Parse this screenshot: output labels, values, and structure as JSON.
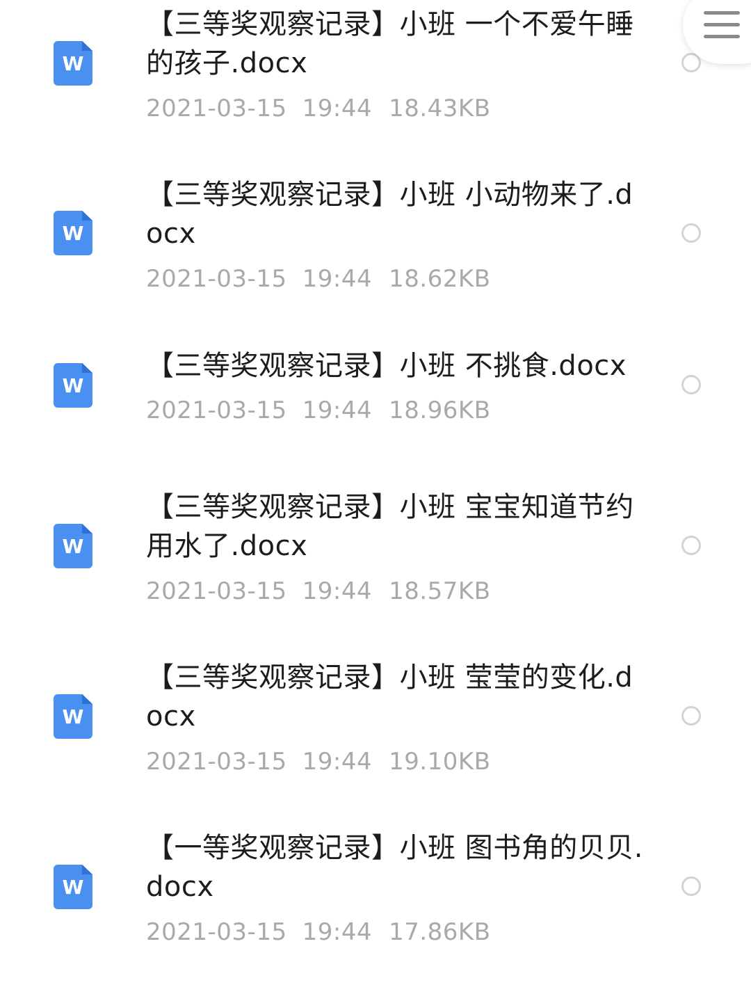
{
  "menu": {
    "icon": "menu-icon"
  },
  "files": [
    {
      "name": "【三等奖观察记录】小班 一个不爱午睡的孩子.docx",
      "date": "2021-03-15",
      "time": "19:44",
      "size": "18.43KB",
      "icon": "word-doc-icon",
      "icon_letter": "W"
    },
    {
      "name": "【三等奖观察记录】小班 小动物来了.docx",
      "date": "2021-03-15",
      "time": "19:44",
      "size": "18.62KB",
      "icon": "word-doc-icon",
      "icon_letter": "W"
    },
    {
      "name": "【三等奖观察记录】小班 不挑食.docx",
      "date": "2021-03-15",
      "time": "19:44",
      "size": "18.96KB",
      "icon": "word-doc-icon",
      "icon_letter": "W"
    },
    {
      "name": "【三等奖观察记录】小班 宝宝知道节约用水了.docx",
      "date": "2021-03-15",
      "time": "19:44",
      "size": "18.57KB",
      "icon": "word-doc-icon",
      "icon_letter": "W"
    },
    {
      "name": "【三等奖观察记录】小班 莹莹的变化.docx",
      "date": "2021-03-15",
      "time": "19:44",
      "size": "19.10KB",
      "icon": "word-doc-icon",
      "icon_letter": "W"
    },
    {
      "name": "【一等奖观察记录】小班 图书角的贝贝.docx",
      "date": "2021-03-15",
      "time": "19:44",
      "size": "17.86KB",
      "icon": "word-doc-icon",
      "icon_letter": "W"
    }
  ],
  "colors": {
    "icon_blue": "#4a90f0",
    "name_text": "#1c1c1c",
    "meta_text": "#a9a9a9",
    "radio_border": "#d3d3d3"
  }
}
